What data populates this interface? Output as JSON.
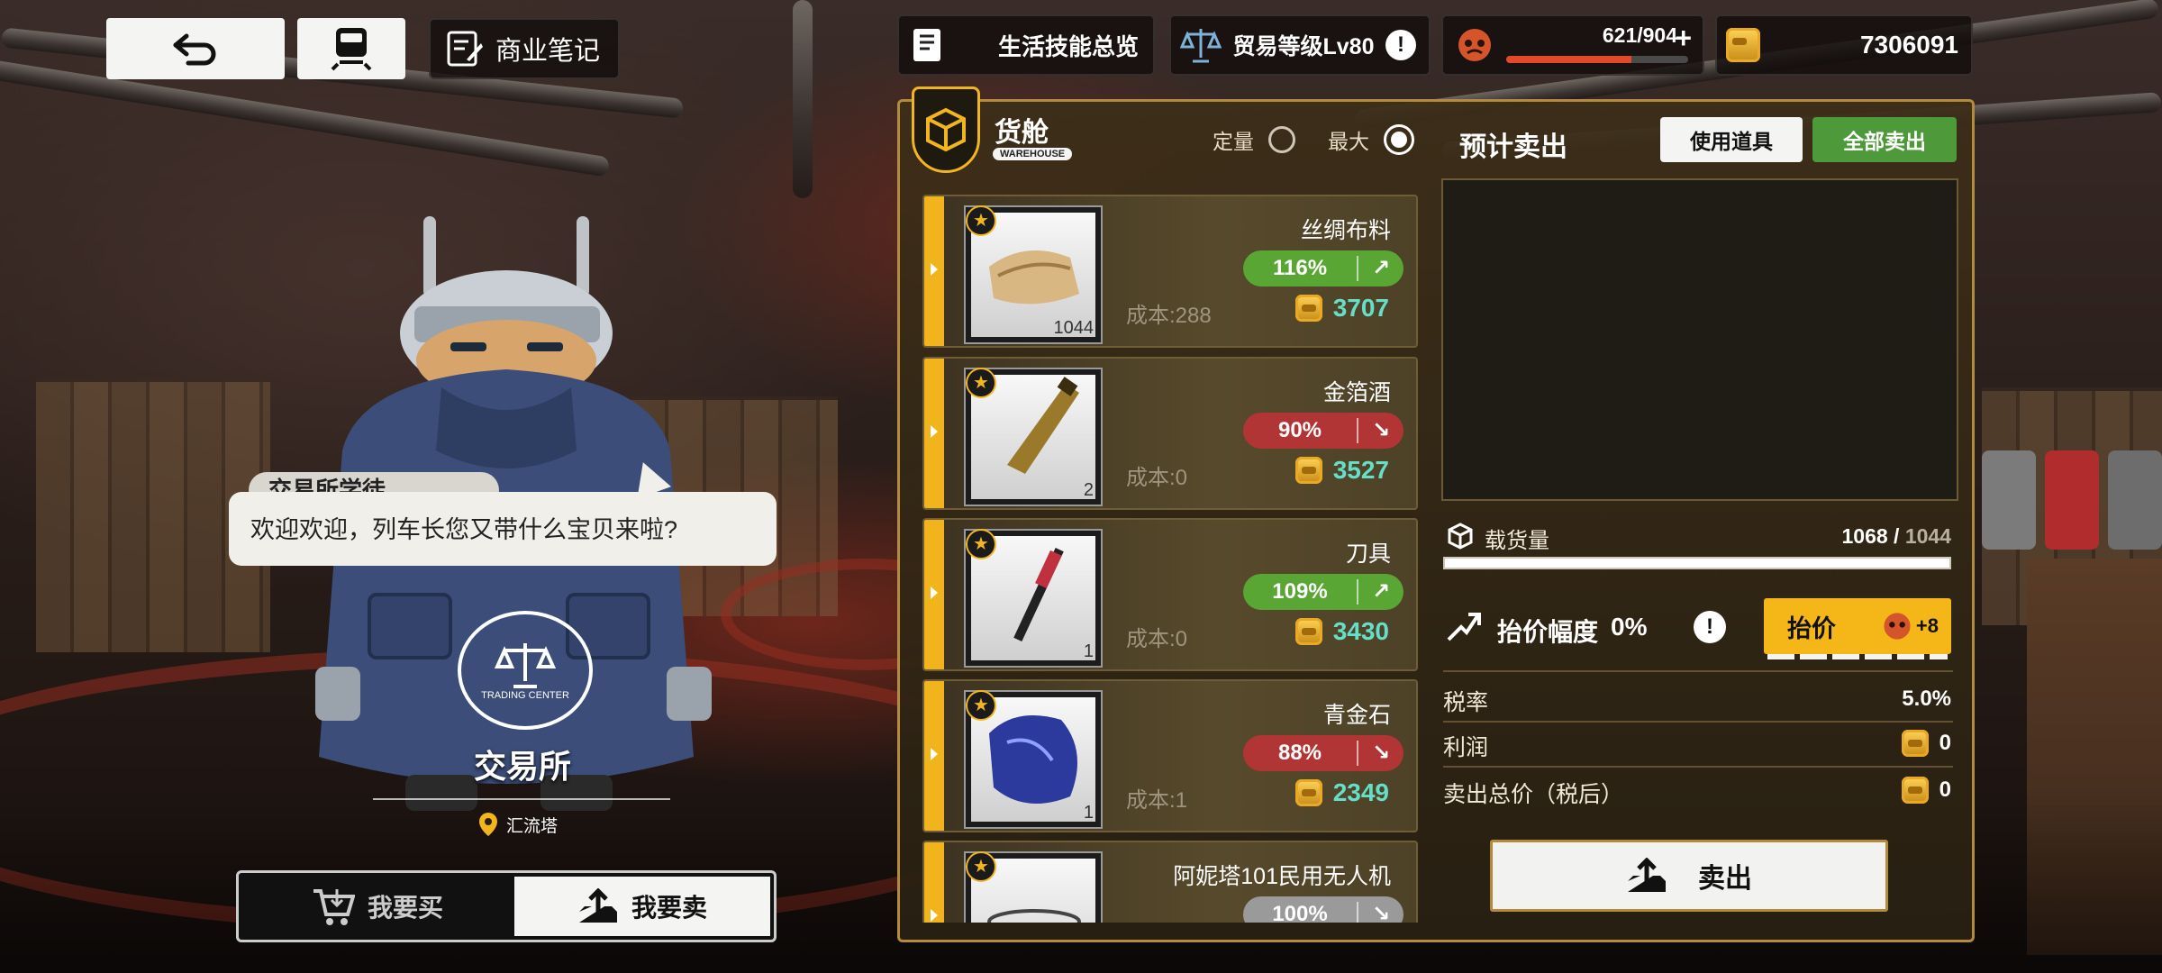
{
  "top_bar": {
    "business_notes_label": "商业笔记",
    "life_skills_label": "生活技能总览",
    "trade_level_label": "贸易等级Lv80",
    "stamina_value": "621/904",
    "stamina_fraction": 0.687,
    "gold_amount": "7306091"
  },
  "npc": {
    "name": "交易所学徒",
    "dialogue": "欢迎欢迎，列车长您又带什么宝贝来啦?",
    "emblem_text": "TRADING CENTER",
    "station_name": "交易所",
    "location": "汇流塔"
  },
  "mode_tabs": {
    "buy_label": "我要买",
    "sell_label": "我要卖",
    "selected": "sell"
  },
  "cargo": {
    "title": "货舱",
    "badge_text": "WAREHOUSE",
    "mode_fixed_label": "定量",
    "mode_max_label": "最大",
    "selected_mode": "max",
    "items": [
      {
        "name": "丝绸布料",
        "quantity": "1044",
        "cost_label": "成本:288",
        "percent": "116%",
        "trend": "up",
        "price": "3707"
      },
      {
        "name": "金箔酒",
        "quantity": "2",
        "cost_label": "成本:0",
        "percent": "90%",
        "trend": "down",
        "price": "3527"
      },
      {
        "name": "刀具",
        "quantity": "1",
        "cost_label": "成本:0",
        "percent": "109%",
        "trend": "up",
        "price": "3430"
      },
      {
        "name": "青金石",
        "quantity": "1",
        "cost_label": "成本:1",
        "percent": "88%",
        "trend": "down",
        "price": "2349"
      },
      {
        "name": "阿妮塔101民用无人机",
        "quantity": "",
        "cost_label": "",
        "percent": "100%",
        "trend": "neutral",
        "price": ""
      }
    ]
  },
  "sell_panel": {
    "title": "预计卖出",
    "use_item_label": "使用道具",
    "sell_all_label": "全部卖出",
    "load_label": "载货量",
    "load_current": "1068",
    "load_separator": " / ",
    "load_max": "1044",
    "load_fraction": 1.0,
    "raise_label": "抬价幅度",
    "raise_value": "0%",
    "raise_button_label": "抬价",
    "raise_cost": "+8",
    "tax_label": "税率",
    "tax_value": "5.0%",
    "profit_label": "利润",
    "profit_value": "0",
    "total_label": "卖出总价（税后）",
    "total_value": "0",
    "sell_button_label": "卖出"
  },
  "colors": {
    "accent_yellow": "#f1b41c",
    "up_green": "#5aa635",
    "down_red": "#b23535",
    "price_teal": "#64e0c8",
    "panel_gold_border": "#b48a3c",
    "sell_all_green": "#4e9a3a"
  }
}
